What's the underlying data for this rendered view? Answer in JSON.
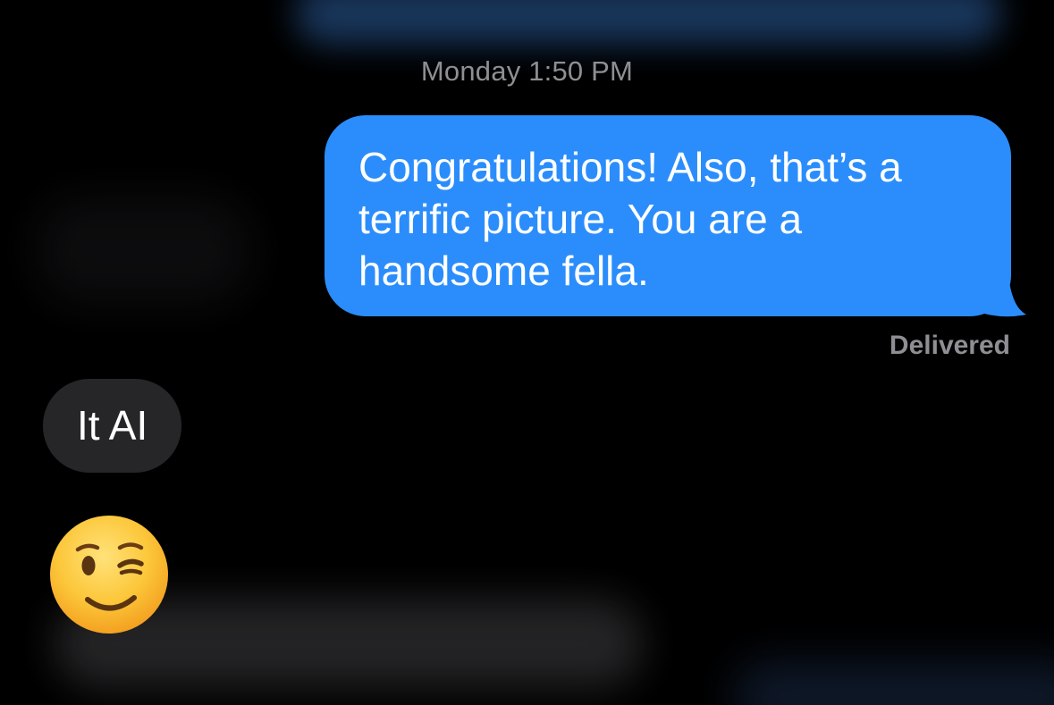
{
  "conversation": {
    "timestamp_day": "Monday",
    "timestamp_time": "1:50 PM",
    "messages": [
      {
        "direction": "outgoing",
        "lines": [
          "Congratulations! Also, that’s a",
          "terrific picture. You are a",
          "handsome fella."
        ],
        "status": "Delivered"
      },
      {
        "direction": "incoming",
        "text": "It AI"
      },
      {
        "direction": "incoming",
        "emoji": "winking-face"
      }
    ]
  },
  "colors": {
    "background": "#000000",
    "outgoing_bubble": "#2b8dfb",
    "incoming_bubble": "#262628",
    "meta_text": "#8e8e93"
  }
}
